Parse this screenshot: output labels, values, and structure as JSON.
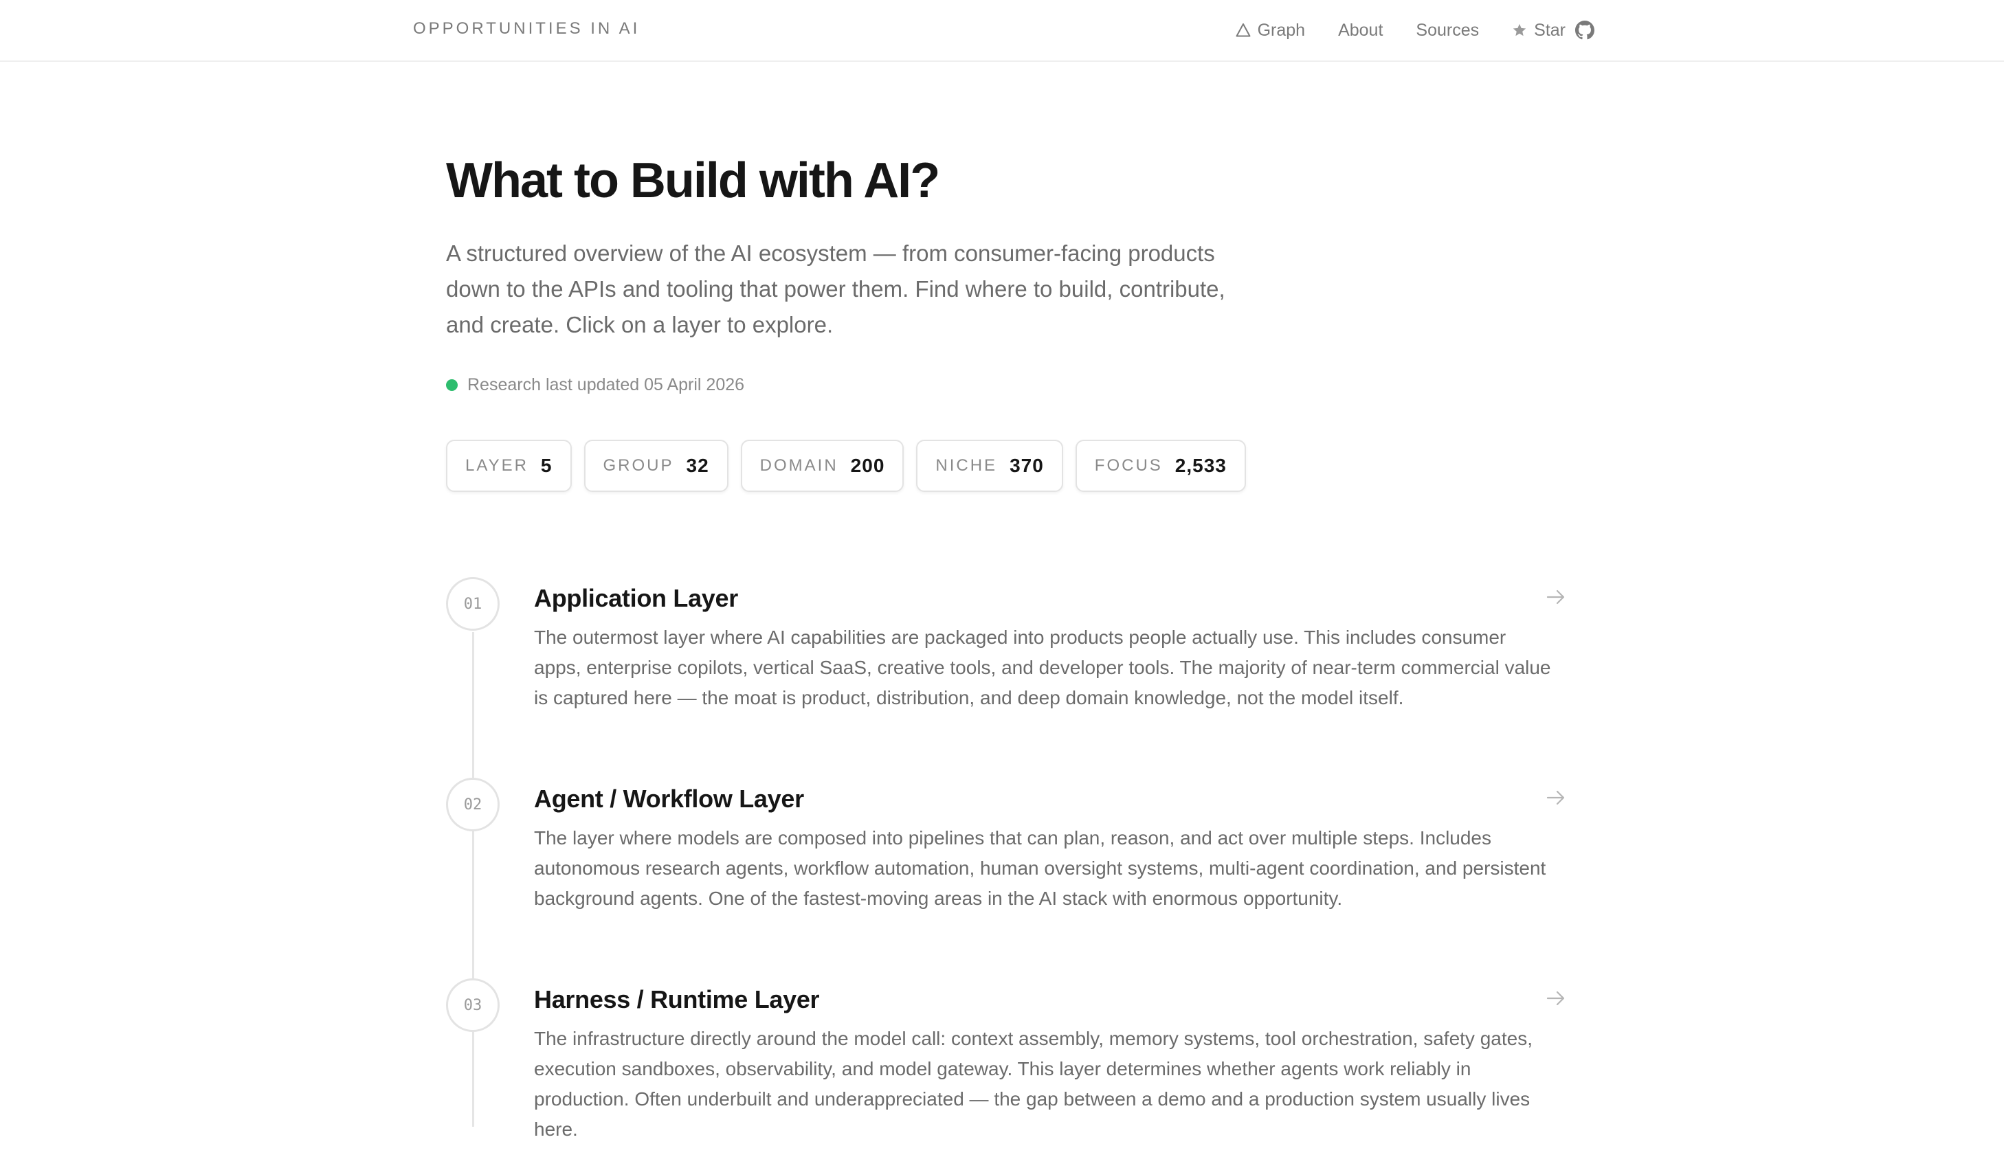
{
  "header": {
    "brand": "OPPORTUNITIES IN AI",
    "nav": {
      "graph": "Graph",
      "about": "About",
      "sources": "Sources",
      "star": "Star"
    }
  },
  "hero": {
    "title": "What to Build with AI?",
    "description": "A structured overview of the AI ecosystem — from consumer-facing products down to the APIs and tooling that power them. Find where to build, contribute, and create. Click on a layer to explore.",
    "updated": "Research last updated 05 April 2026",
    "status_color": "#2ebd6e"
  },
  "stats": [
    {
      "label": "LAYER",
      "value": "5"
    },
    {
      "label": "GROUP",
      "value": "32"
    },
    {
      "label": "DOMAIN",
      "value": "200"
    },
    {
      "label": "NICHE",
      "value": "370"
    },
    {
      "label": "FOCUS",
      "value": "2,533"
    }
  ],
  "layers": [
    {
      "number": "01",
      "title": "Application Layer",
      "description": "The outermost layer where AI capabilities are packaged into products people actually use. This includes consumer apps, enterprise copilots, vertical SaaS, creative tools, and developer tools. The majority of near-term commercial value is captured here — the moat is product, distribution, and deep domain knowledge, not the model itself."
    },
    {
      "number": "02",
      "title": "Agent / Workflow Layer",
      "description": "The layer where models are composed into pipelines that can plan, reason, and act over multiple steps. Includes autonomous research agents, workflow automation, human oversight systems, multi-agent coordination, and persistent background agents. One of the fastest-moving areas in the AI stack with enormous opportunity."
    },
    {
      "number": "03",
      "title": "Harness / Runtime Layer",
      "description": "The infrastructure directly around the model call: context assembly, memory systems, tool orchestration, safety gates, execution sandboxes, observability, and model gateway. This layer determines whether agents work reliably in production. Often underbuilt and underappreciated — the gap between a demo and a production system usually lives here."
    }
  ]
}
